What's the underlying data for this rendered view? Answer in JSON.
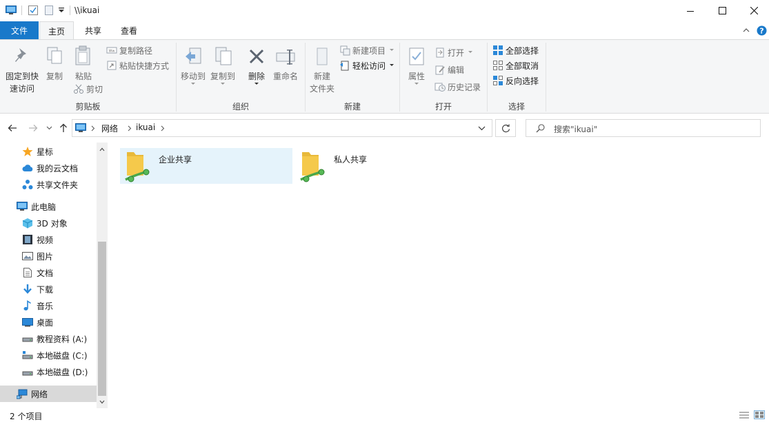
{
  "window": {
    "title": "\\\\ikuai"
  },
  "tabs": [
    {
      "label": "文件"
    },
    {
      "label": "主页"
    },
    {
      "label": "共享"
    },
    {
      "label": "查看"
    }
  ],
  "ribbon": {
    "clipboard": {
      "label": "剪贴板",
      "pin_line1": "固定到快",
      "pin_line2": "速访问",
      "copy": "复制",
      "paste": "粘贴",
      "copy_path": "复制路径",
      "paste_shortcut": "粘贴快捷方式",
      "cut": "剪切"
    },
    "organize": {
      "label": "组织",
      "move_to": "移动到",
      "copy_to": "复制到",
      "delete": "删除",
      "rename": "重命名"
    },
    "new": {
      "label": "新建",
      "new_folder_line1": "新建",
      "new_folder_line2": "文件夹",
      "new_item": "新建项目",
      "easy_access": "轻松访问"
    },
    "open": {
      "label": "打开",
      "properties": "属性",
      "open": "打开",
      "edit": "编辑",
      "history": "历史记录"
    },
    "select": {
      "label": "选择",
      "select_all": "全部选择",
      "select_none": "全部取消",
      "invert": "反向选择"
    }
  },
  "address": {
    "crumbs": [
      "网络",
      "ikuai"
    ],
    "search_placeholder": "搜索\"ikuai\""
  },
  "sidebar": {
    "items": [
      {
        "label": "星标",
        "icon": "star-icon"
      },
      {
        "label": "我的云文档",
        "icon": "cloud-icon"
      },
      {
        "label": "共享文件夹",
        "icon": "shared-folder-icon"
      },
      {
        "label": "此电脑",
        "icon": "computer-icon"
      },
      {
        "label": "3D 对象",
        "icon": "cube-icon"
      },
      {
        "label": "视频",
        "icon": "video-icon"
      },
      {
        "label": "图片",
        "icon": "picture-icon"
      },
      {
        "label": "文档",
        "icon": "document-icon"
      },
      {
        "label": "下载",
        "icon": "download-icon"
      },
      {
        "label": "音乐",
        "icon": "music-icon"
      },
      {
        "label": "桌面",
        "icon": "desktop-icon"
      },
      {
        "label": "教程资料 (A:)",
        "icon": "network-drive-icon"
      },
      {
        "label": "本地磁盘 (C:)",
        "icon": "system-drive-icon"
      },
      {
        "label": "本地磁盘 (D:)",
        "icon": "drive-icon"
      },
      {
        "label": "网络",
        "icon": "network-icon"
      }
    ]
  },
  "content": {
    "items": [
      {
        "name": "企业共享",
        "selected": true
      },
      {
        "name": "私人共享",
        "selected": false
      }
    ]
  },
  "status": {
    "count": "2 个项目"
  },
  "colors": {
    "accent": "#1979ca",
    "selection": "#e5f3fb",
    "folder": "#f5c94b"
  }
}
